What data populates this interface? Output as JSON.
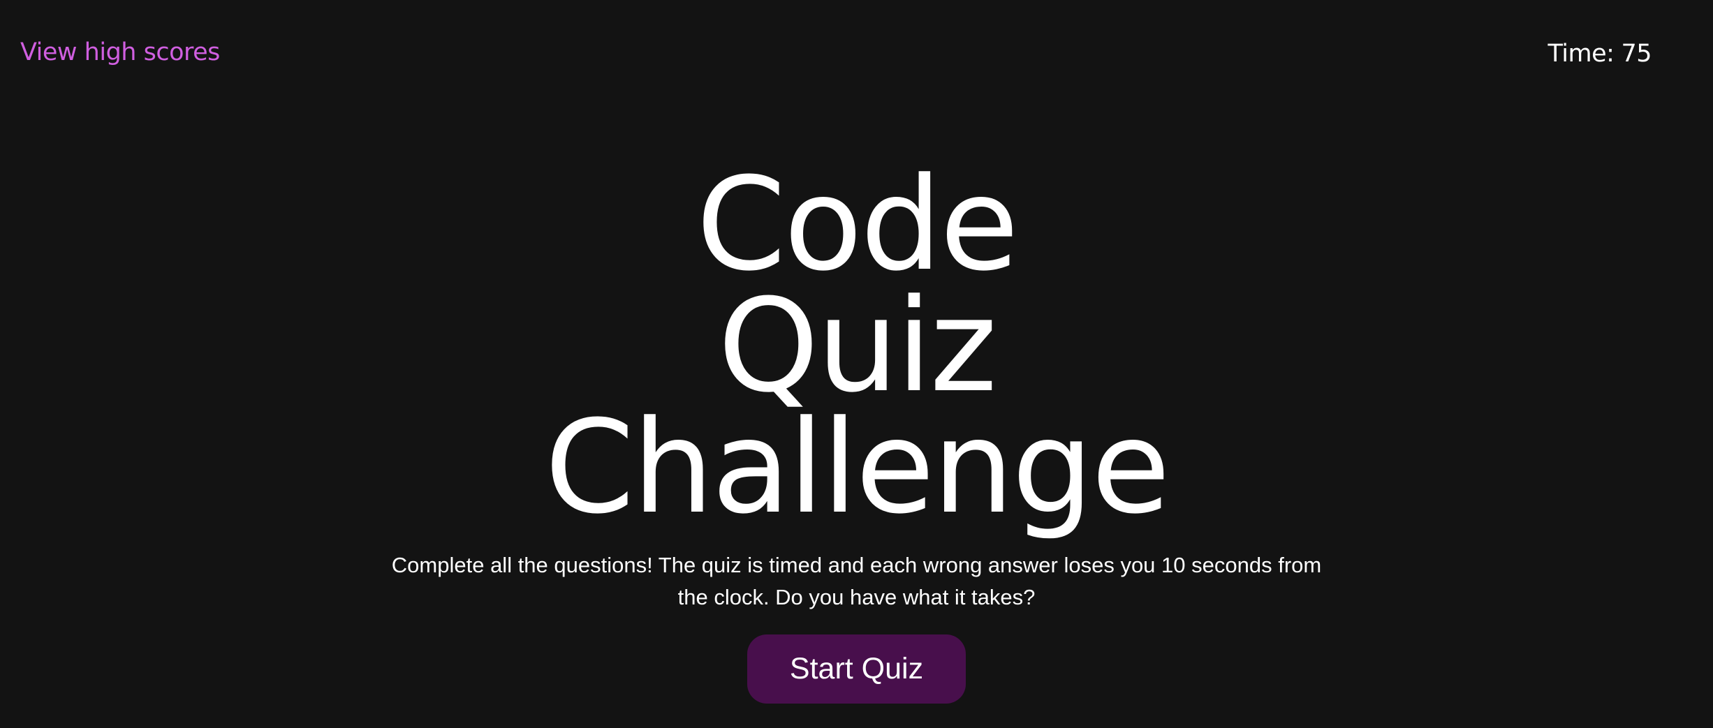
{
  "header": {
    "high_scores_label": "View high scores",
    "timer_label": "Time:",
    "timer_value": "75"
  },
  "main": {
    "title_line1": "Code Quiz",
    "title_line2": "Challenge",
    "description": "Complete all the questions! The quiz is timed and each wrong answer loses you 10 seconds from the clock. Do you have what it takes?",
    "start_button_label": "Start Quiz"
  },
  "colors": {
    "background": "#131313",
    "link": "#d05fe0",
    "button": "#480f4c",
    "text": "#ffffff"
  }
}
